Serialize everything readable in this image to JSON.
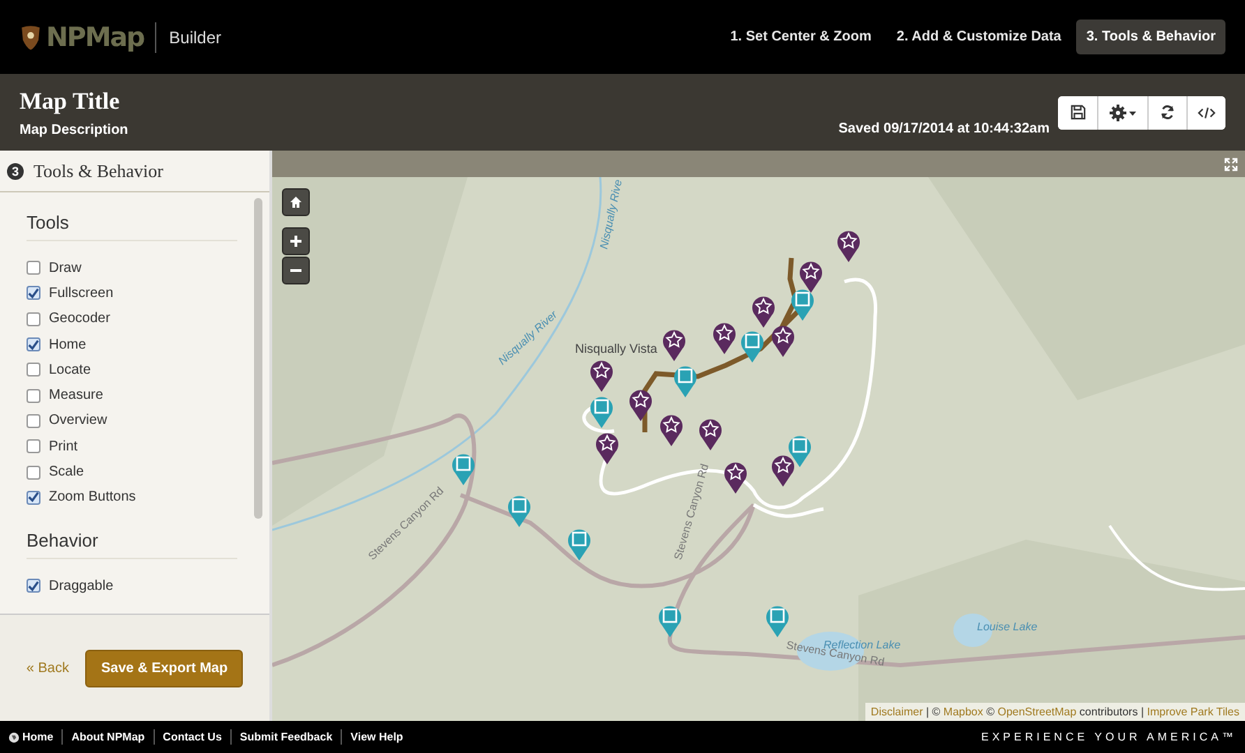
{
  "header": {
    "logo": "NPMap",
    "app_name": "Builder",
    "steps": [
      {
        "label": "1. Set Center & Zoom",
        "selected": false
      },
      {
        "label": "2. Add & Customize Data",
        "selected": false
      },
      {
        "label": "3. Tools & Behavior",
        "selected": true
      }
    ]
  },
  "map_info": {
    "title": "Map Title",
    "description": "Map Description",
    "saved": "Saved 09/17/2014 at 10:44:32am"
  },
  "sidebar": {
    "step_number": "3",
    "heading": "Tools & Behavior",
    "sections": [
      {
        "title": "Tools",
        "options": [
          {
            "label": "Draw",
            "checked": false
          },
          {
            "label": "Fullscreen",
            "checked": true
          },
          {
            "label": "Geocoder",
            "checked": false
          },
          {
            "label": "Home",
            "checked": true
          },
          {
            "label": "Locate",
            "checked": false
          },
          {
            "label": "Measure",
            "checked": false
          },
          {
            "label": "Overview",
            "checked": false
          },
          {
            "label": "Print",
            "checked": false
          },
          {
            "label": "Scale",
            "checked": false
          },
          {
            "label": "Zoom Buttons",
            "checked": true
          }
        ]
      },
      {
        "title": "Behavior",
        "options": [
          {
            "label": "Draggable",
            "checked": true
          }
        ]
      }
    ],
    "back": "« Back",
    "save": "Save & Export Map"
  },
  "map": {
    "labels": [
      {
        "text": "Nisqually Vista",
        "kind": "place"
      },
      {
        "text": "Nisqually River",
        "kind": "water"
      },
      {
        "text": "Nisqually Rive",
        "kind": "water"
      },
      {
        "text": "Stevens Canyon Rd",
        "kind": "road"
      },
      {
        "text": "Stevens Canyon Rd",
        "kind": "road"
      },
      {
        "text": "Stevens Canyon Rd",
        "kind": "road"
      },
      {
        "text": "Reflection Lake",
        "kind": "water"
      },
      {
        "text": "Louise Lake",
        "kind": "water"
      }
    ],
    "markers": [
      {
        "kind": "star"
      },
      {
        "kind": "star"
      },
      {
        "kind": "star"
      },
      {
        "kind": "star"
      },
      {
        "kind": "star"
      },
      {
        "kind": "star"
      },
      {
        "kind": "star"
      },
      {
        "kind": "star"
      },
      {
        "kind": "star"
      },
      {
        "kind": "star"
      },
      {
        "kind": "star"
      },
      {
        "kind": "star"
      },
      {
        "kind": "star"
      },
      {
        "kind": "square"
      },
      {
        "kind": "square"
      },
      {
        "kind": "square"
      },
      {
        "kind": "square"
      },
      {
        "kind": "square"
      },
      {
        "kind": "square"
      },
      {
        "kind": "square"
      },
      {
        "kind": "square"
      },
      {
        "kind": "square"
      },
      {
        "kind": "square"
      }
    ],
    "attribution": [
      {
        "text": "Disclaimer",
        "kind": "link"
      },
      {
        "text": " | © ",
        "kind": "text"
      },
      {
        "text": "Mapbox",
        "kind": "link"
      },
      {
        "text": " © ",
        "kind": "text"
      },
      {
        "text": "OpenStreetMap",
        "kind": "link"
      },
      {
        "text": " contributors | ",
        "kind": "text"
      },
      {
        "text": "Improve Park Tiles",
        "kind": "link"
      }
    ]
  },
  "footer": {
    "links": [
      "Home",
      "About NPMap",
      "Contact Us",
      "Submit Feedback",
      "View Help"
    ],
    "tagline": "EXPERIENCE YOUR AMERICA™"
  }
}
